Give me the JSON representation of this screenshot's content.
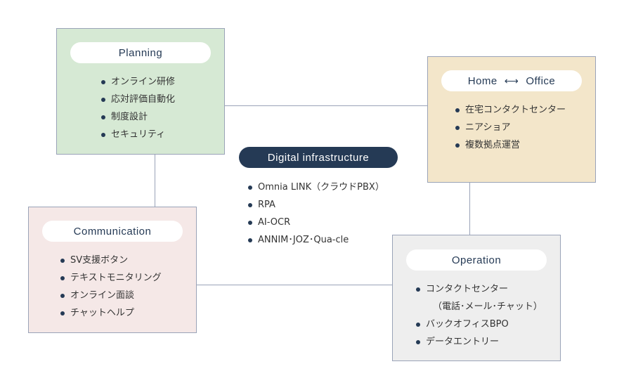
{
  "colors": {
    "planning": "#d6e9d4",
    "home_office": "#f3e6ca",
    "communication": "#f5e8e7",
    "operation": "#eeeeee",
    "navy": "#253a55",
    "border": "#9aa3b8"
  },
  "planning": {
    "title": "Planning",
    "items": [
      "オンライン研修",
      "応対評価自動化",
      "制度設計",
      "セキュリティ"
    ]
  },
  "home_office": {
    "title_left": "Home",
    "arrow_icon": "left-right-arrow",
    "title_right": "Office",
    "items": [
      "在宅コンタクトセンター",
      "ニアショア",
      "複数拠点運営"
    ]
  },
  "digital": {
    "title": "Digital infrastructure",
    "items": [
      "Omnia LINK（クラウドPBX）",
      "RPA",
      "AI-OCR",
      "ANNIM･JOZ･Qua-cle"
    ]
  },
  "communication": {
    "title": "Communication",
    "items": [
      "SV支援ボタン",
      "テキストモニタリング",
      "オンライン面談",
      "チャットヘルプ"
    ]
  },
  "operation": {
    "title": "Operation",
    "items": [
      "コンタクトセンター",
      "（電話･メール･チャット）",
      "バックオフィスBPO",
      "データエントリー"
    ]
  }
}
